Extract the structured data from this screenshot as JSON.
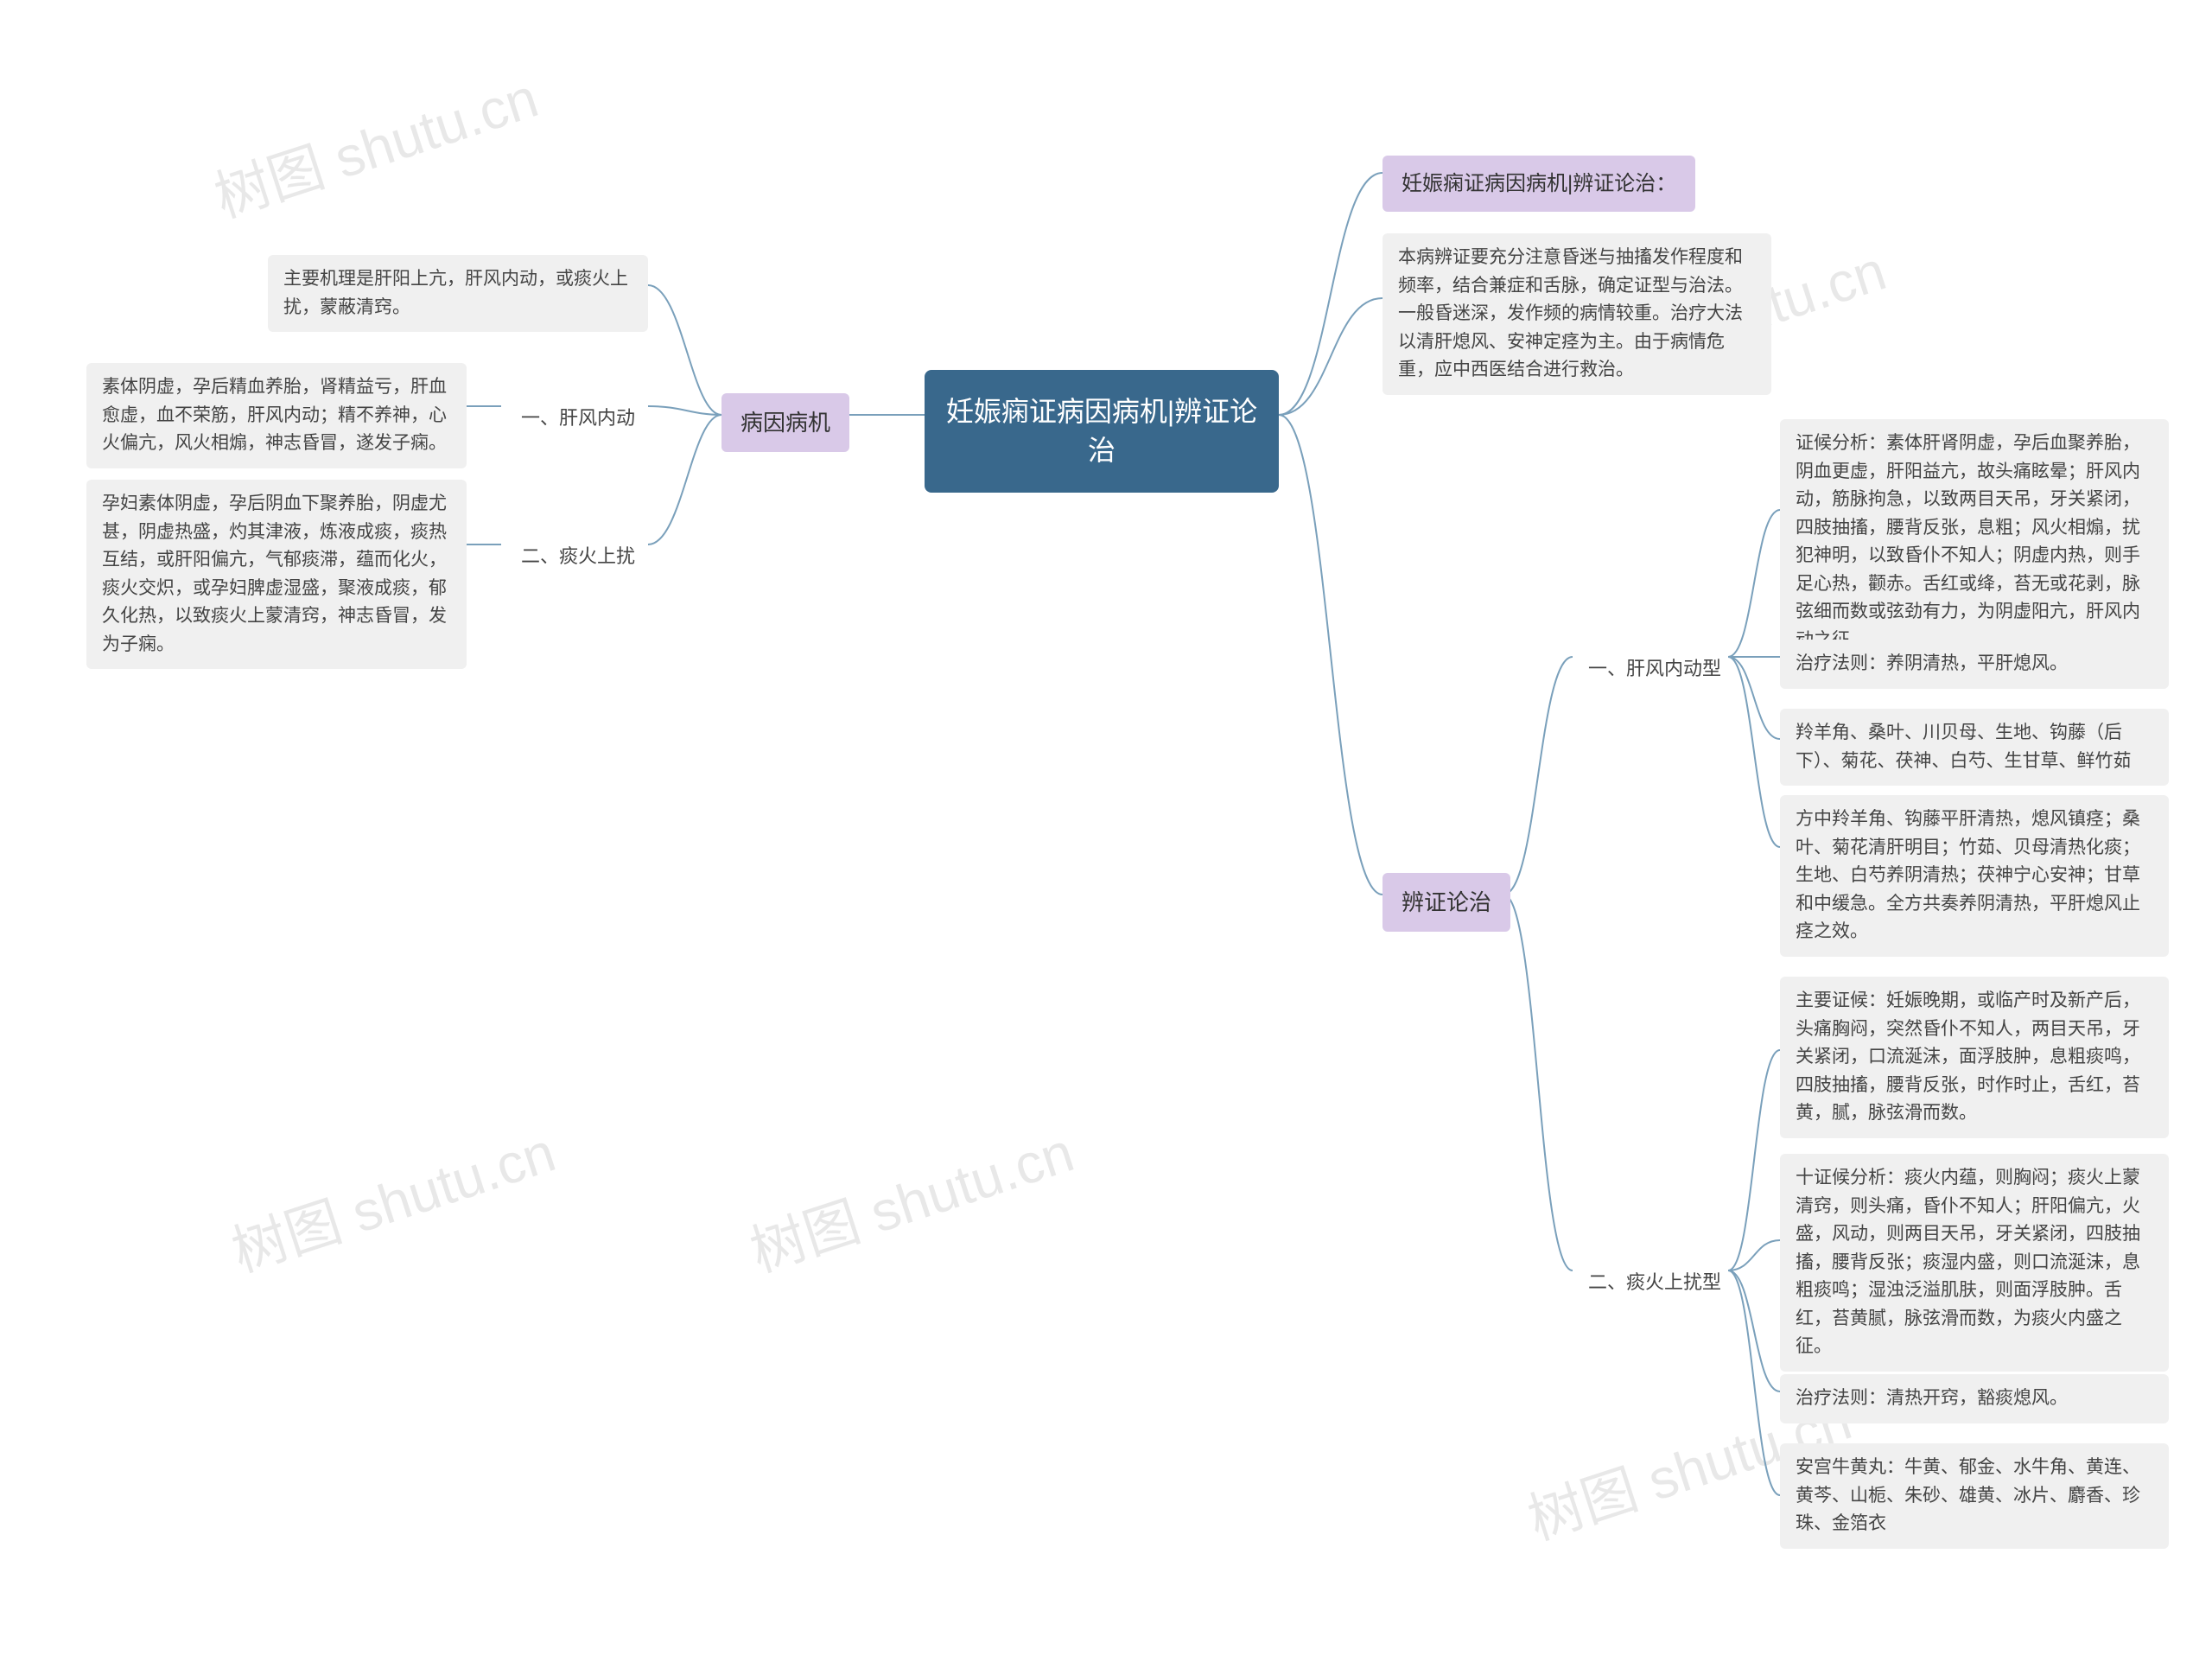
{
  "watermark": "树图 shutu.cn",
  "root": {
    "title": "妊娠痫证病因病机|辨证论治"
  },
  "left": {
    "title": "病因病机",
    "intro": "主要机理是肝阳上亢，肝风内动，或痰火上扰，蒙蔽清窍。",
    "items": [
      {
        "label": "一、肝风内动",
        "text": "素体阴虚，孕后精血养胎，肾精益亏，肝血愈虚，血不荣筋，肝风内动；精不养神，心火偏亢，风火相煽，神志昏冒，遂发子痫。"
      },
      {
        "label": "二、痰火上扰",
        "text": "孕妇素体阴虚，孕后阴血下聚养胎，阴虚尤甚，阴虚热盛，灼其津液，炼液成痰，痰热互结，或肝阳偏亢，气郁痰滞，蕴而化火，痰火交炽，或孕妇脾虚湿盛，聚液成痰，郁久化热，以致痰火上蒙清窍，神志昏冒，发为子痫。"
      }
    ]
  },
  "right": {
    "header": "妊娠痫证病因病机|辨证论治：",
    "overview": "本病辨证要充分注意昏迷与抽搐发作程度和频率，结合兼症和舌脉，确定证型与治法。一般昏迷深，发作频的病情较重。治疗大法以清肝熄风、安神定痉为主。由于病情危重，应中西医结合进行救治。",
    "title": "辨证论治",
    "types": [
      {
        "label": "一、肝风内动型",
        "blocks": [
          "证候分析：素体肝肾阴虚，孕后血聚养胎，阴血更虚，肝阳益亢，故头痛眩晕；肝风内动，筋脉拘急，以致两目天吊，牙关紧闭，四肢抽搐，腰背反张，息粗；风火相煽，扰犯神明，以致昏仆不知人；阴虚内热，则手足心热，颧赤。舌红或绛，苔无或花剥，脉弦细而数或弦劲有力，为阴虚阳亢，肝风内动之征。",
          "治疗法则：养阴清热，平肝熄风。",
          "羚羊角、桑叶、川贝母、生地、钩藤（后下）、菊花、茯神、白芍、生甘草、鲜竹茹",
          "方中羚羊角、钩藤平肝清热，熄风镇痉；桑叶、菊花清肝明目；竹茹、贝母清热化痰；生地、白芍养阴清热；茯神宁心安神；甘草和中缓急。全方共奏养阴清热，平肝熄风止痉之效。"
        ]
      },
      {
        "label": "二、痰火上扰型",
        "blocks": [
          "主要证候：妊娠晚期，或临产时及新产后，头痛胸闷，突然昏仆不知人，两目天吊，牙关紧闭，口流涎沫，面浮肢肿，息粗痰鸣，四肢抽搐，腰背反张，时作时止，舌红，苔黄，腻，脉弦滑而数。",
          "十证候分析：痰火内蕴，则胸闷；痰火上蒙清窍，则头痛，昏仆不知人；肝阳偏亢，火盛，风动，则两目天吊，牙关紧闭，四肢抽搐，腰背反张；痰湿内盛，则口流涎沫，息粗痰鸣；湿浊泛溢肌肤，则面浮肢肿。舌红，苔黄腻，脉弦滑而数，为痰火内盛之征。",
          "治疗法则：清热开窍，豁痰熄风。",
          "安宫牛黄丸：牛黄、郁金、水牛角、黄连、黄芩、山栀、朱砂、雄黄、冰片、麝香、珍珠、金箔衣"
        ]
      }
    ]
  }
}
